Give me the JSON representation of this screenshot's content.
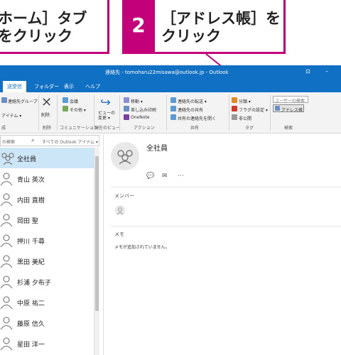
{
  "callouts": {
    "left_text": "ホーム］タブ\nをクリック",
    "step_number": "2",
    "right_text": "［アドレス帳］を\nクリック"
  },
  "window": {
    "title": "連絡先 - tomoharu22misawa@outlook.jp - Outlook",
    "controls": [
      "⊡",
      "–"
    ]
  },
  "ribbon_tabs": [
    "送受信",
    "フォルダー",
    "表示",
    "ヘルプ"
  ],
  "ribbon": {
    "new_group_cut": "連絡先グループ",
    "new_items_cut": "アイテム ▾",
    "delete_label": "削除",
    "meeting_label": "会議",
    "more_label": "その他 ▾",
    "view_change_label": "ビューの\n変更 ▾",
    "move_label": "移動 ▾",
    "merge_print_label": "差し込み印刷",
    "onenote_label": "OneNote",
    "forward_contact_label": "連絡先の転送 ▾",
    "share_contacts_label": "連絡先の共有",
    "open_shared_label": "共有の連絡先を開く",
    "categorize_label": "分類 ▾",
    "follow_up_label": "フラグの設定 ▾",
    "private_label": "非公開",
    "search_people_placeholder": "ユーザーの検索",
    "address_book_label": "アドレス帳",
    "groups": [
      "成",
      "削除",
      "コミュニケーション",
      "現在のビュー",
      "アクション",
      "共有",
      "タグ",
      "検索"
    ]
  },
  "search": {
    "placeholder": "の検索",
    "scope": "すべての Outlook アイテム ▾"
  },
  "contacts": [
    {
      "name": "全社員",
      "type": "group",
      "selected": true
    },
    {
      "name": "青山 英次",
      "type": "person"
    },
    {
      "name": "内田 直樹",
      "type": "person"
    },
    {
      "name": "岡田 聖",
      "type": "person"
    },
    {
      "name": "押川 千尋",
      "type": "person"
    },
    {
      "name": "黒田 美紀",
      "type": "person"
    },
    {
      "name": "杉浦 夕布子",
      "type": "person"
    },
    {
      "name": "中原 祐二",
      "type": "person"
    },
    {
      "name": "藤原 信久",
      "type": "person"
    },
    {
      "name": "星田 洋一",
      "type": "person"
    }
  ],
  "reading_pane": {
    "title": "全社員",
    "actions": [
      "💬",
      "✉",
      "⋯"
    ],
    "members_label": "メンバー",
    "memo_label": "メモ",
    "memo_text": "メモが追加されていません。"
  },
  "colors": {
    "accent": "#c3007a",
    "titlebar": "#1070c4",
    "selection": "#cde6f7"
  }
}
